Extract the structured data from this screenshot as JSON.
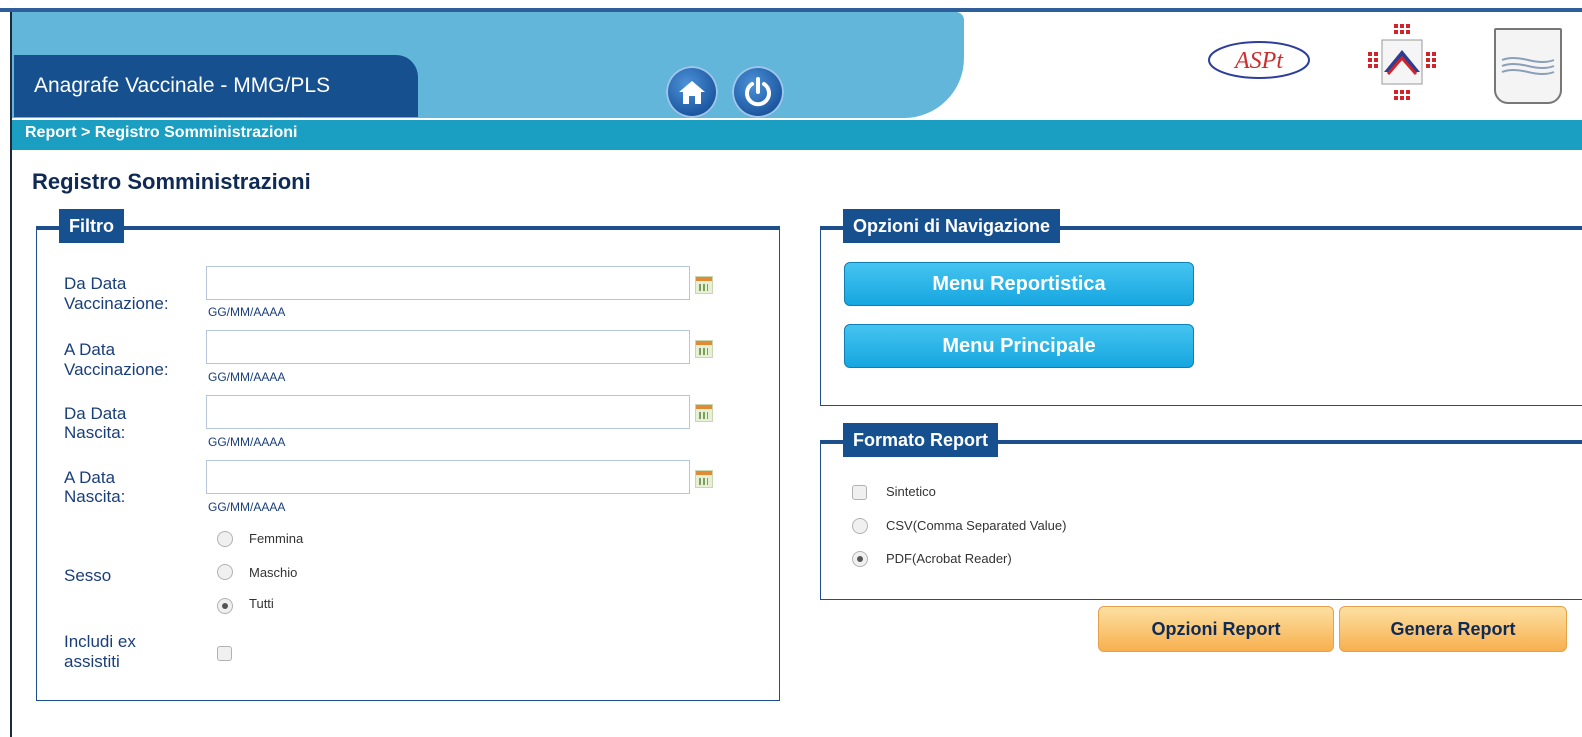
{
  "header": {
    "app_title": "Anagrafe Vaccinale - MMG/PLS",
    "home_icon": "home-icon",
    "power_icon": "power-icon",
    "logo_asp_text": "ASPt",
    "breadcrumb": "Report > Registro Somministrazioni"
  },
  "page": {
    "title": "Registro Somministrazioni"
  },
  "filtro": {
    "legend": "Filtro",
    "da_data_vacc_label_1": "Da Data",
    "da_data_vacc_label_2": "Vaccinazione:",
    "a_data_vacc_label_1": "A Data",
    "a_data_vacc_label_2": "Vaccinazione:",
    "da_data_nasc_label_1": "Da Data",
    "da_data_nasc_label_2": "Nascita:",
    "a_data_nasc_label_1": "A Data",
    "a_data_nasc_label_2": "Nascita:",
    "date_hint": "GG/MM/AAAA",
    "date_value": "",
    "sesso_label": "Sesso",
    "sesso_options": [
      "Femmina",
      "Maschio",
      "Tutti"
    ],
    "sesso_selected": "Tutti",
    "includi_label_1": "Includi ex",
    "includi_label_2": "assistiti",
    "includi_checked": false
  },
  "navigazione": {
    "legend": "Opzioni di Navigazione",
    "menu_reportistica": "Menu Reportistica",
    "menu_principale": "Menu Principale"
  },
  "formato": {
    "legend": "Formato Report",
    "sintetico": "Sintetico",
    "csv": "CSV(Comma Separated Value)",
    "pdf": "PDF(Acrobat Reader)",
    "selected": "PDF(Acrobat Reader)"
  },
  "actions": {
    "opzioni_report": "Opzioni Report",
    "genera_report": "Genera Report"
  },
  "colors": {
    "header_light_blue": "#62b6da",
    "header_dark_blue": "#17508f",
    "breadcrumb_bar": "#1a9fc3",
    "nav_button": "#16a6e0",
    "orange_button": "#f7b04f"
  }
}
